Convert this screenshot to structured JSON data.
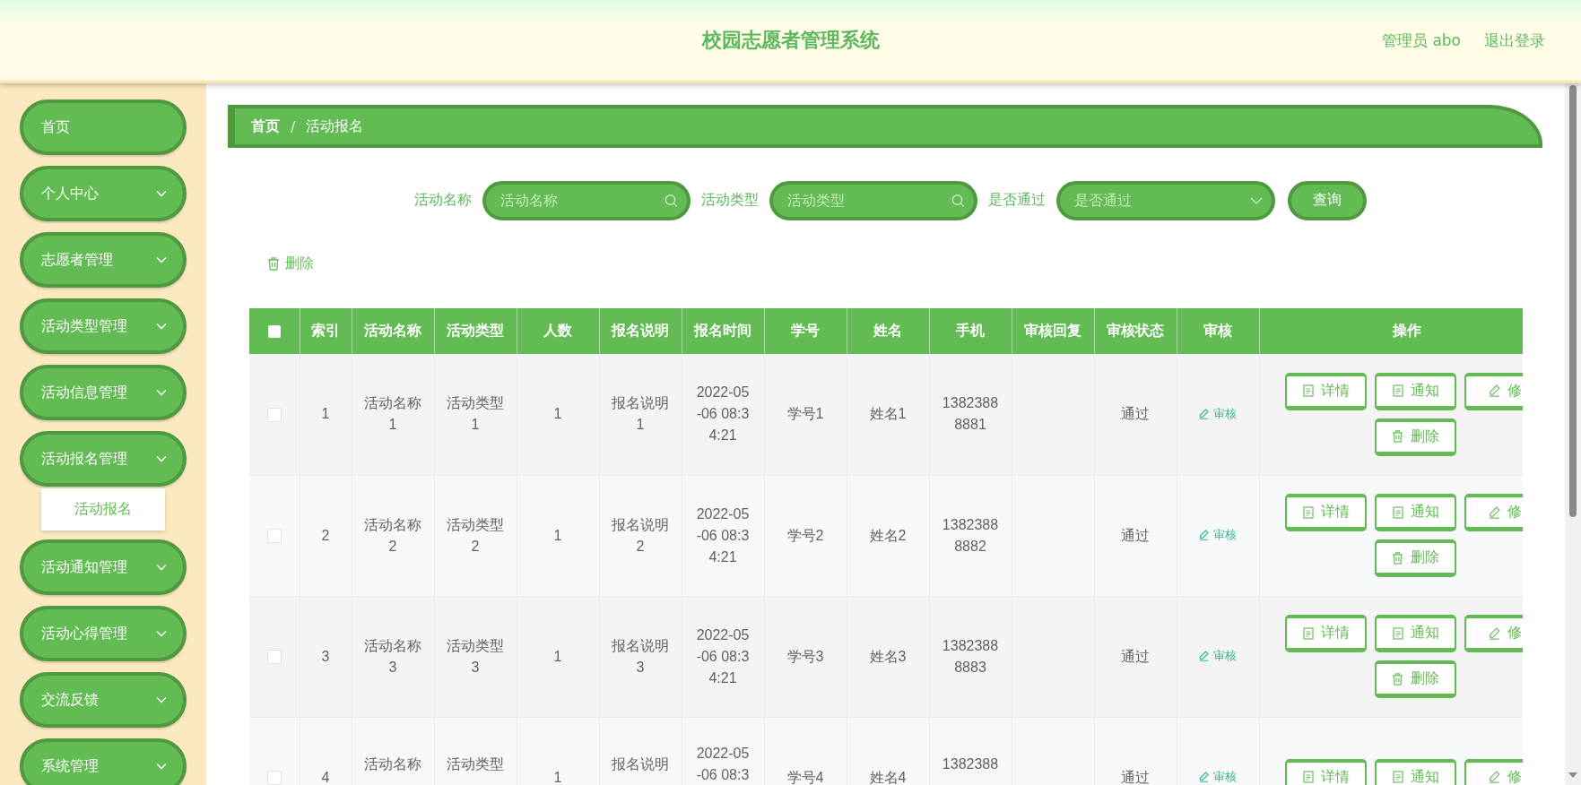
{
  "header": {
    "title": "校园志愿者管理系统",
    "user": "管理员 abo",
    "logout": "退出登录"
  },
  "sidebar": {
    "items": [
      {
        "label": "首页",
        "kind": "link"
      },
      {
        "label": "个人中心",
        "kind": "menu"
      },
      {
        "label": "志愿者管理",
        "kind": "menu"
      },
      {
        "label": "活动类型管理",
        "kind": "menu"
      },
      {
        "label": "活动信息管理",
        "kind": "menu"
      },
      {
        "label": "活动报名管理",
        "kind": "menu",
        "children": [
          {
            "label": "活动报名"
          }
        ]
      },
      {
        "label": "活动通知管理",
        "kind": "menu"
      },
      {
        "label": "活动心得管理",
        "kind": "menu"
      },
      {
        "label": "交流反馈",
        "kind": "menu"
      },
      {
        "label": "系统管理",
        "kind": "menu"
      }
    ]
  },
  "breadcrumb": {
    "separator": "/",
    "items": [
      {
        "label": "首页",
        "current": false
      },
      {
        "label": "活动报名",
        "current": true
      }
    ]
  },
  "search": {
    "fields": [
      {
        "label": "活动名称",
        "placeholder": "活动名称",
        "kind": "text"
      },
      {
        "label": "活动类型",
        "placeholder": "活动类型",
        "kind": "text"
      },
      {
        "label": "是否通过",
        "placeholder": "是否通过",
        "kind": "select"
      }
    ],
    "button": "查询"
  },
  "toolbar": {
    "delete": "删除"
  },
  "table": {
    "select_all_checked": false,
    "columns": [
      "索引",
      "活动名称",
      "活动类型",
      "人数",
      "报名说明",
      "报名时间",
      "学号",
      "姓名",
      "手机",
      "审核回复",
      "审核状态",
      "审核",
      "操作"
    ],
    "rows": [
      {
        "checked": false,
        "index": "1",
        "name": "活动名称1",
        "type": "活动类型1",
        "count": "1",
        "note": "报名说明1",
        "time": "2022-05-06 08:34:21",
        "student_no": "学号1",
        "student_name": "姓名1",
        "phone": "13823888881",
        "status": "通过",
        "review": "审核",
        "actions": [
          {
            "label": "详情",
            "kind": "detail"
          },
          {
            "label": "通知",
            "kind": "notice"
          },
          {
            "label": "修",
            "kind": "edit"
          },
          {
            "label": "删除",
            "kind": "delete"
          }
        ]
      },
      {
        "checked": false,
        "index": "2",
        "name": "活动名称2",
        "type": "活动类型2",
        "count": "1",
        "note": "报名说明2",
        "time": "2022-05-06 08:34:21",
        "student_no": "学号2",
        "student_name": "姓名2",
        "phone": "13823888882",
        "status": "通过",
        "review": "审核",
        "actions": [
          {
            "label": "详情",
            "kind": "detail"
          },
          {
            "label": "通知",
            "kind": "notice"
          },
          {
            "label": "修",
            "kind": "edit"
          },
          {
            "label": "删除",
            "kind": "delete"
          }
        ]
      },
      {
        "checked": false,
        "index": "3",
        "name": "活动名称3",
        "type": "活动类型3",
        "count": "1",
        "note": "报名说明3",
        "time": "2022-05-06 08:34:21",
        "student_no": "学号3",
        "student_name": "姓名3",
        "phone": "13823888883",
        "status": "通过",
        "review": "审核",
        "actions": [
          {
            "label": "详情",
            "kind": "detail"
          },
          {
            "label": "通知",
            "kind": "notice"
          },
          {
            "label": "修",
            "kind": "edit"
          },
          {
            "label": "删除",
            "kind": "delete"
          }
        ]
      },
      {
        "checked": false,
        "index": "4",
        "name": "活动名称",
        "type": "活动类型",
        "count": "1",
        "note": "报名说明",
        "time": "2022-05-06 08:3",
        "student_no": "学号4",
        "student_name": "姓名4",
        "phone": "1382388",
        "status": "通过",
        "review": "审核",
        "actions": [
          {
            "label": "详情",
            "kind": "detail"
          },
          {
            "label": "通知",
            "kind": "notice"
          },
          {
            "label": "修",
            "kind": "edit"
          }
        ]
      }
    ]
  }
}
